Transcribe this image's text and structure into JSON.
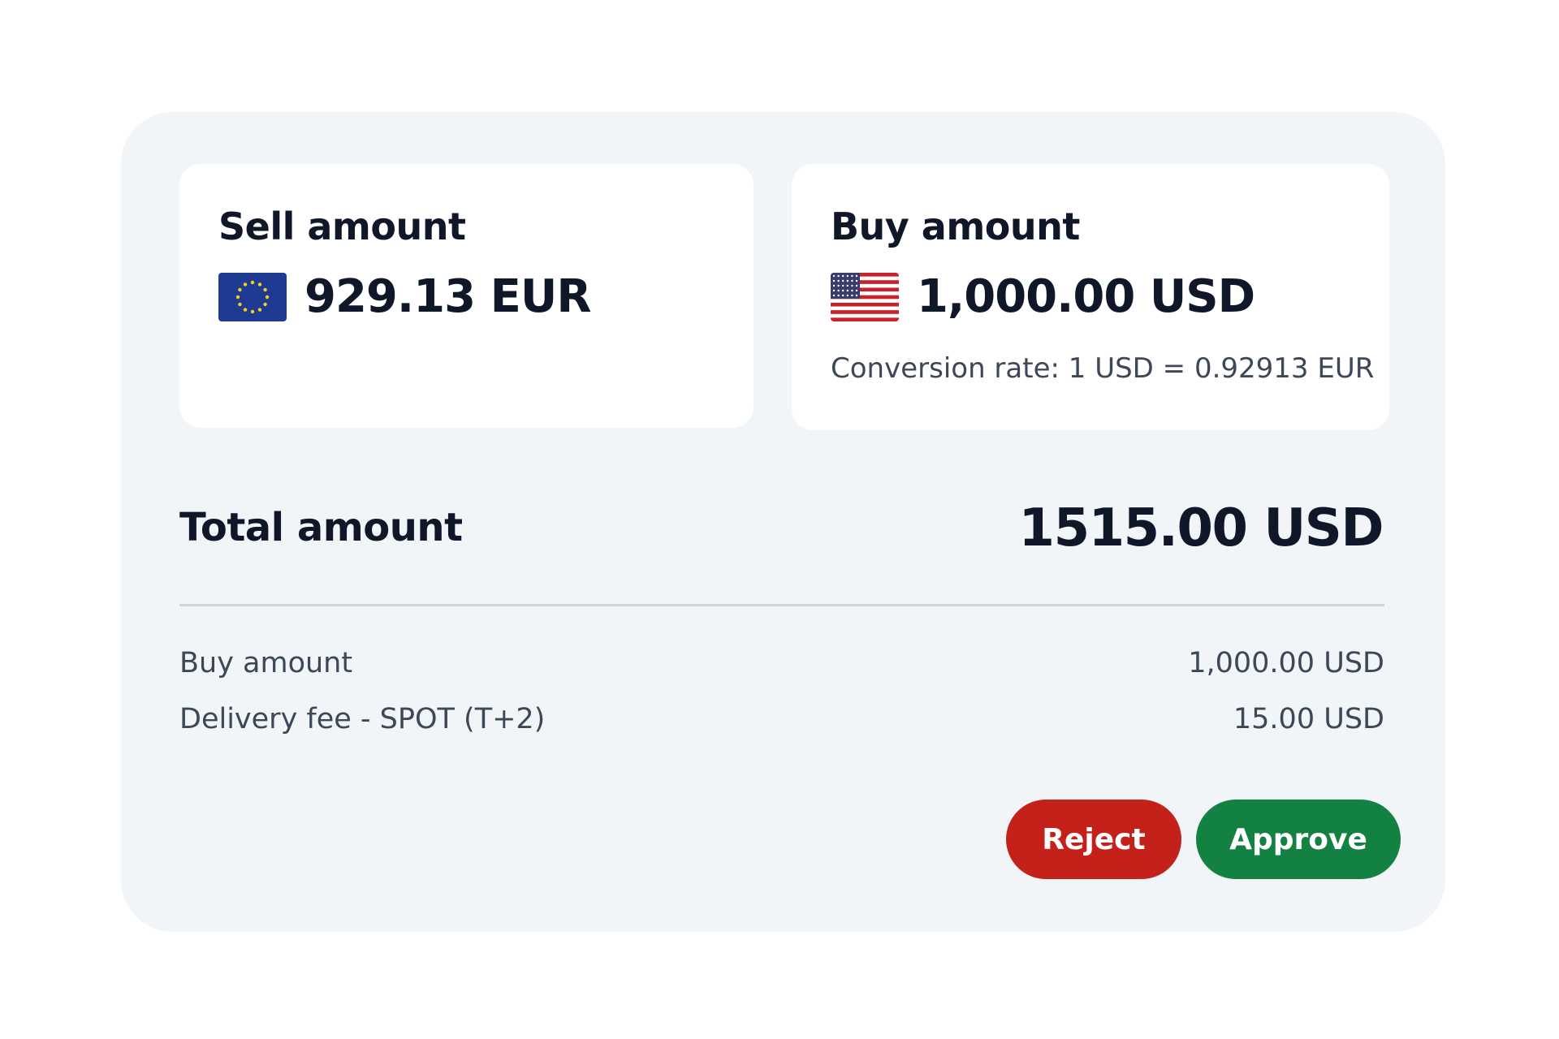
{
  "sell": {
    "title": "Sell amount",
    "amount": "929.13 EUR",
    "flag_icon": "eu-flag-icon"
  },
  "buy": {
    "title": "Buy amount",
    "amount": "1,000.00 USD",
    "flag_icon": "us-flag-icon",
    "conversion_rate": "Conversion rate: 1 USD = 0.92913 EUR"
  },
  "total": {
    "label": "Total amount",
    "value": "1515.00 USD"
  },
  "breakdown": [
    {
      "label": "Buy amount",
      "value": "1,000.00 USD"
    },
    {
      "label": "Delivery fee - SPOT (T+2)",
      "value": "15.00 USD"
    }
  ],
  "actions": {
    "reject_label": "Reject",
    "approve_label": "Approve"
  },
  "colors": {
    "panel_background": "#f1f5f8",
    "reject": "#c4211b",
    "approve": "#128141",
    "text_primary": "#0f1729",
    "text_secondary": "#3c4757"
  }
}
